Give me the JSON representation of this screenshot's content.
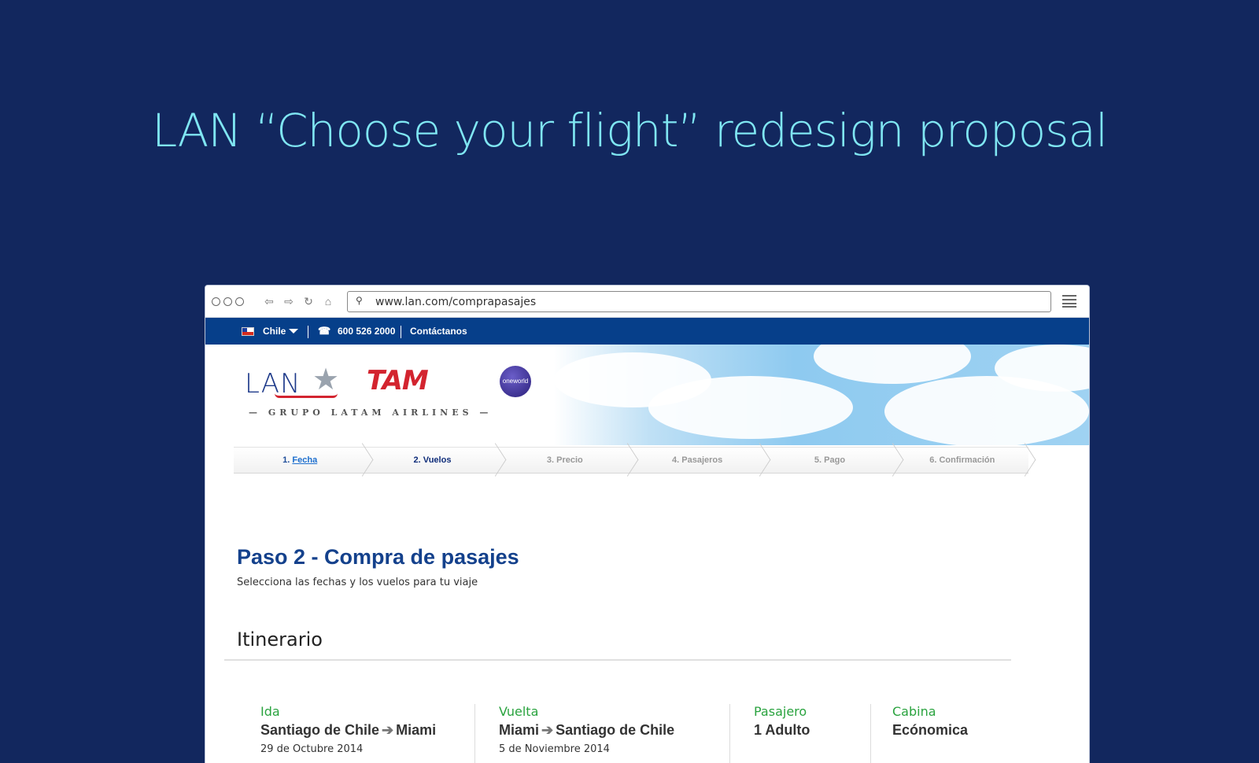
{
  "headline": "LAN “Choose your flight”  redesign proposal",
  "browser": {
    "url": "www.lan.com/comprapasajes",
    "icons": [
      "back-icon",
      "forward-icon",
      "reload-icon",
      "home-icon",
      "search-icon",
      "menu-icon"
    ]
  },
  "topbar": {
    "country": "Chile",
    "phone": "600 526 2000",
    "contact": "Contáctanos"
  },
  "hero": {
    "lan_logo": "LAN",
    "tam_logo": "TAM",
    "group_text": "— GRUPO  LATAM  AIRLINES —",
    "oneworld": "oneworld"
  },
  "steps": [
    {
      "number": "1.",
      "label": "Fecha",
      "state": "done"
    },
    {
      "number": "2.",
      "label": "Vuelos",
      "state": "active"
    },
    {
      "number": "3.",
      "label": "Precio",
      "state": "pending"
    },
    {
      "number": "4.",
      "label": "Pasajeros",
      "state": "pending"
    },
    {
      "number": "5.",
      "label": "Pago",
      "state": "pending"
    },
    {
      "number": "6.",
      "label": "Confirmación",
      "state": "pending"
    }
  ],
  "page": {
    "title": "Paso 2 - Compra de pasajes",
    "subtitle": "Selecciona las fechas y los vuelos para tu viaje"
  },
  "itinerary": {
    "title": "Itinerario",
    "ida": {
      "label": "Ida",
      "from": "Santiago de Chile",
      "to": "Miami",
      "date": "29 de Octubre 2014"
    },
    "vuelta": {
      "label": "Vuelta",
      "from": "Miami",
      "to": "Santiago de Chile",
      "date": "5 de Noviembre 2014"
    },
    "pasajero": {
      "label": "Pasajero",
      "value": "1 Adulto"
    },
    "cabina": {
      "label": "Cabina",
      "value": "Ecónomica"
    }
  },
  "colors": {
    "background": "#12275e",
    "headline": "#7fe6f2",
    "topbar": "#063f8a",
    "title_blue": "#14418c",
    "label_green": "#2aa33f"
  }
}
